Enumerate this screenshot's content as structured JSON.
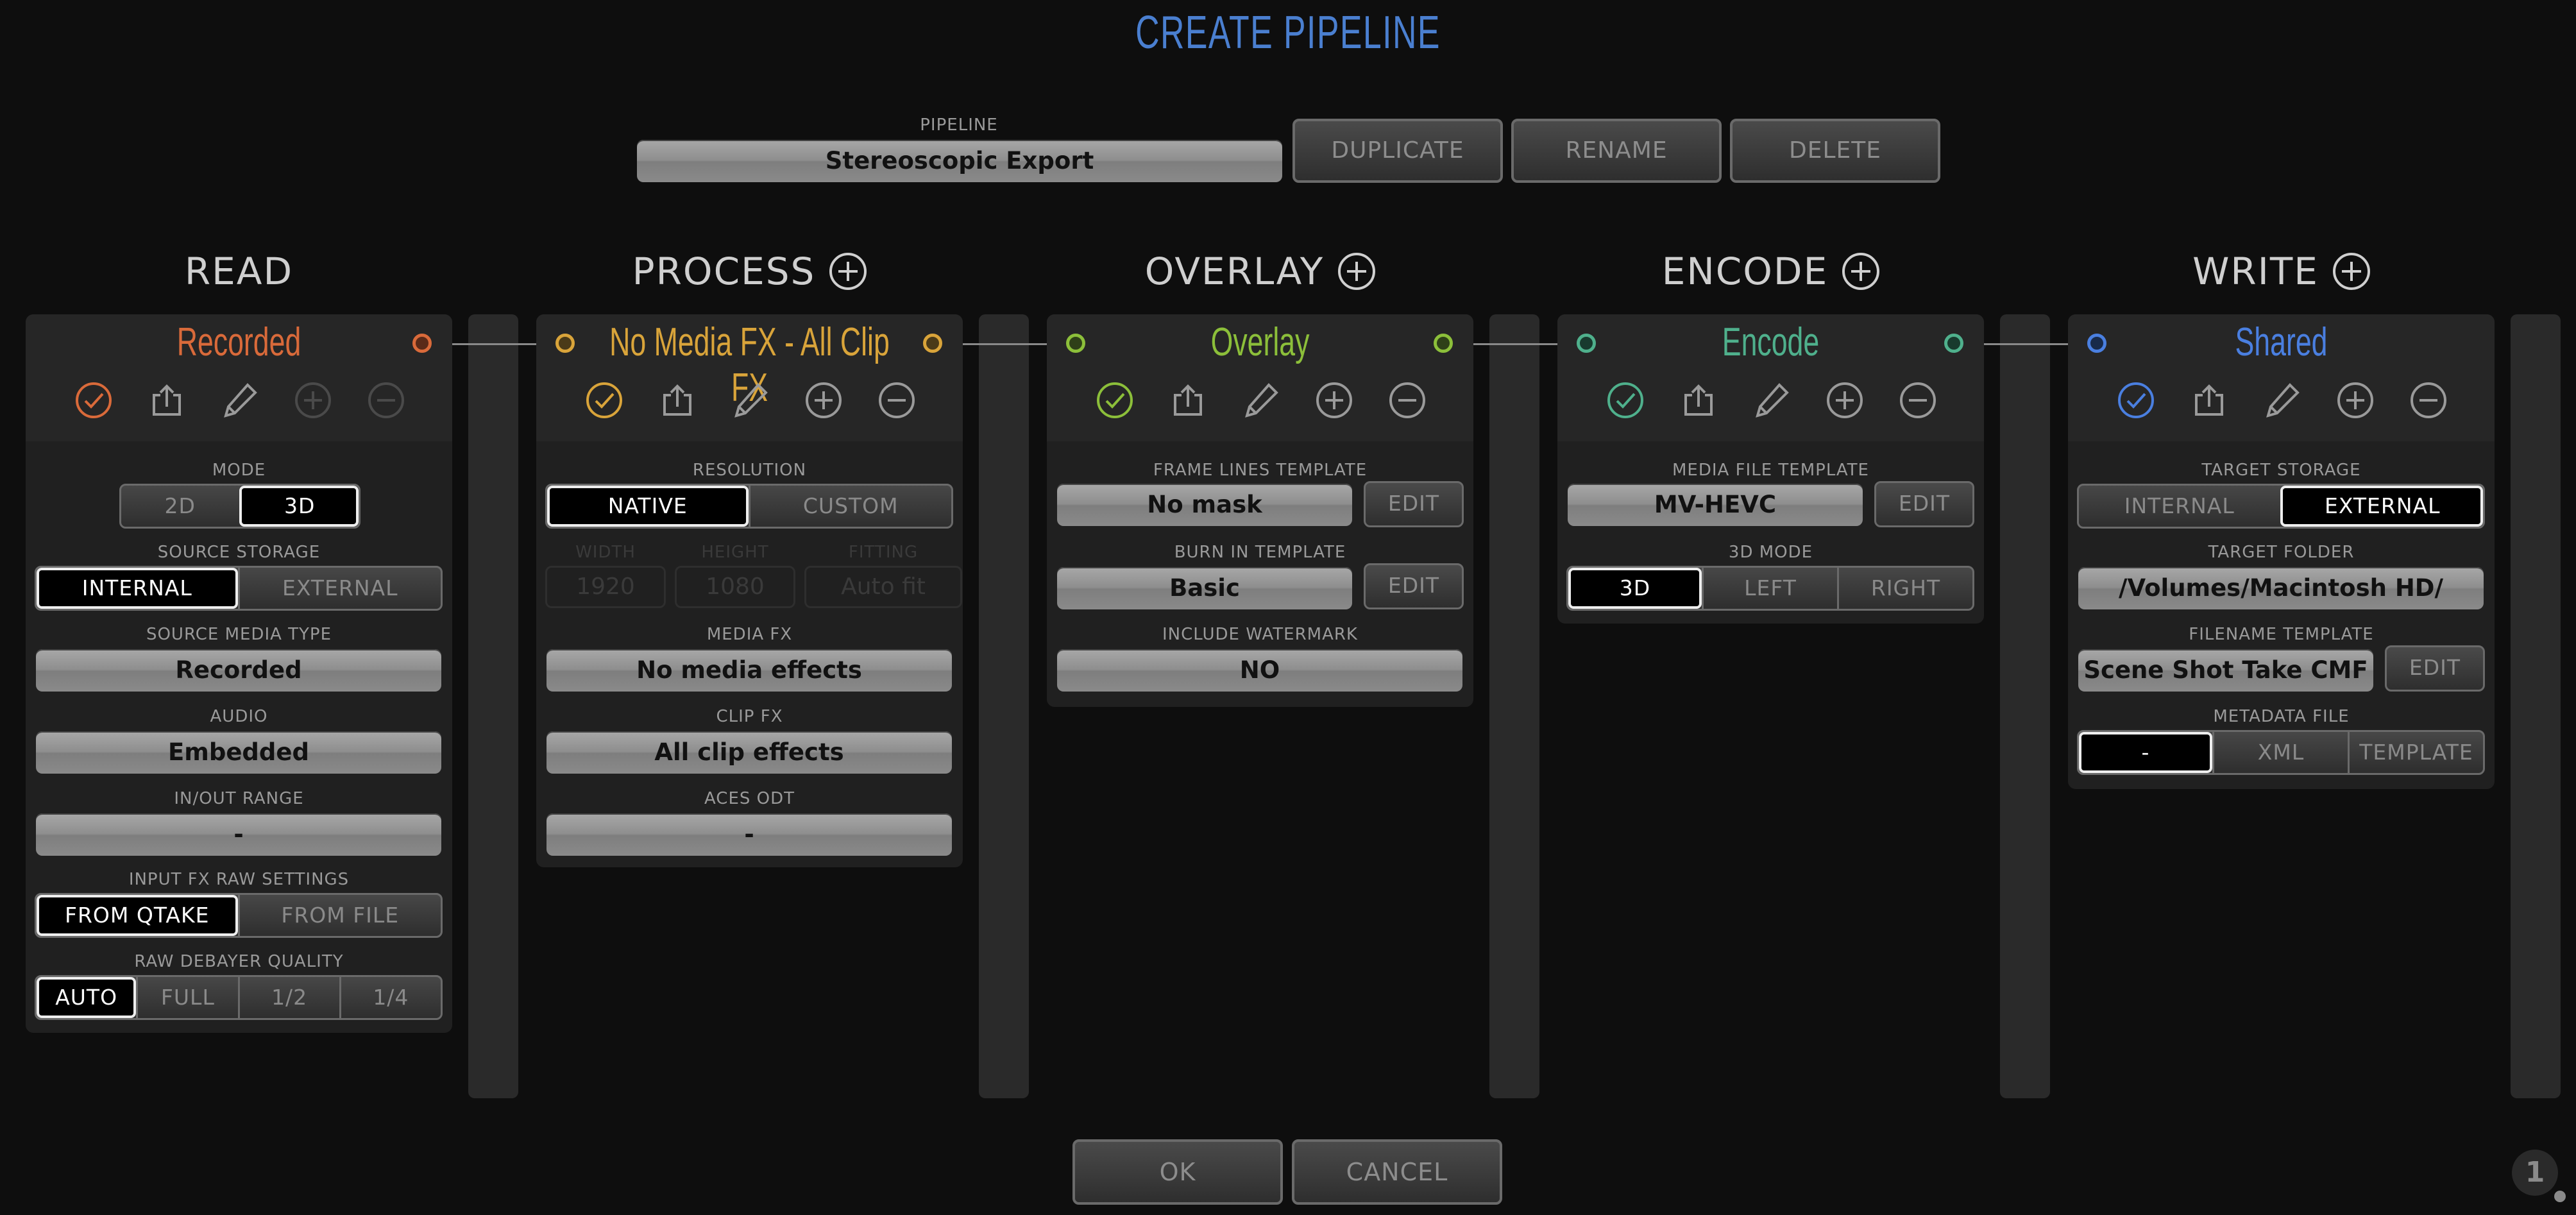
{
  "title": "CREATE PIPELINE",
  "pipeline": {
    "label": "PIPELINE",
    "value": "Stereoscopic Export",
    "duplicate": "DUPLICATE",
    "rename": "RENAME",
    "delete": "DELETE"
  },
  "columns": {
    "read": "READ",
    "process": "PROCESS",
    "overlay": "OVERLAY",
    "encode": "ENCODE",
    "write": "WRITE"
  },
  "colors": {
    "read": "#d96a3a",
    "process": "#d9a43a",
    "overlay": "#8cbf3a",
    "encode": "#4fb08c",
    "write": "#4a7fe0"
  },
  "read": {
    "title": "Recorded",
    "mode_label": "MODE",
    "mode_options": [
      "2D",
      "3D"
    ],
    "mode_selected": "3D",
    "storage_label": "SOURCE STORAGE",
    "storage_options": [
      "INTERNAL",
      "EXTERNAL"
    ],
    "storage_selected": "INTERNAL",
    "media_type_label": "SOURCE MEDIA TYPE",
    "media_type_value": "Recorded",
    "audio_label": "AUDIO",
    "audio_value": "Embedded",
    "inout_label": "IN/OUT RANGE",
    "inout_value": "-",
    "rawfx_label": "INPUT FX RAW SETTINGS",
    "rawfx_options": [
      "FROM QTAKE",
      "FROM FILE"
    ],
    "rawfx_selected": "FROM QTAKE",
    "debayer_label": "RAW DEBAYER QUALITY",
    "debayer_options": [
      "AUTO",
      "FULL",
      "1/2",
      "1/4"
    ],
    "debayer_selected": "AUTO"
  },
  "process": {
    "title": "No Media FX - All Clip FX",
    "resolution_label": "RESOLUTION",
    "resolution_options": [
      "NATIVE",
      "CUSTOM"
    ],
    "resolution_selected": "NATIVE",
    "width_label": "WIDTH",
    "width_value": "1920",
    "height_label": "HEIGHT",
    "height_value": "1080",
    "fitting_label": "FITTING",
    "fitting_value": "Auto fit",
    "mediafx_label": "MEDIA FX",
    "mediafx_value": "No media effects",
    "clipfx_label": "CLIP FX",
    "clipfx_value": "All clip effects",
    "aces_label": "ACES ODT",
    "aces_value": "-"
  },
  "overlay": {
    "title": "Overlay",
    "frame_label": "FRAME LINES TEMPLATE",
    "frame_value": "No mask",
    "frame_edit": "EDIT",
    "burn_label": "BURN IN TEMPLATE",
    "burn_value": "Basic",
    "burn_edit": "EDIT",
    "watermark_label": "INCLUDE WATERMARK",
    "watermark_value": "NO"
  },
  "encode": {
    "title": "Encode",
    "template_label": "MEDIA FILE TEMPLATE",
    "template_value": "MV-HEVC",
    "template_edit": "EDIT",
    "mode3d_label": "3D MODE",
    "mode3d_options": [
      "3D",
      "LEFT",
      "RIGHT"
    ],
    "mode3d_selected": "3D"
  },
  "write": {
    "title": "Shared",
    "storage_label": "TARGET STORAGE",
    "storage_options": [
      "INTERNAL",
      "EXTERNAL"
    ],
    "storage_selected": "EXTERNAL",
    "folder_label": "TARGET FOLDER",
    "folder_value": "/Volumes/Macintosh HD/",
    "filename_label": "FILENAME TEMPLATE",
    "filename_value": "Scene Shot Take CMF",
    "filename_edit": "EDIT",
    "metadata_label": "METADATA FILE",
    "metadata_options": [
      "-",
      "XML",
      "TEMPLATE"
    ],
    "metadata_selected": "-"
  },
  "footer": {
    "ok": "OK",
    "cancel": "CANCEL",
    "badge": "1"
  },
  "icons": [
    "check-icon",
    "share-icon",
    "pencil-icon",
    "plus-circle-icon",
    "minus-circle-icon"
  ]
}
